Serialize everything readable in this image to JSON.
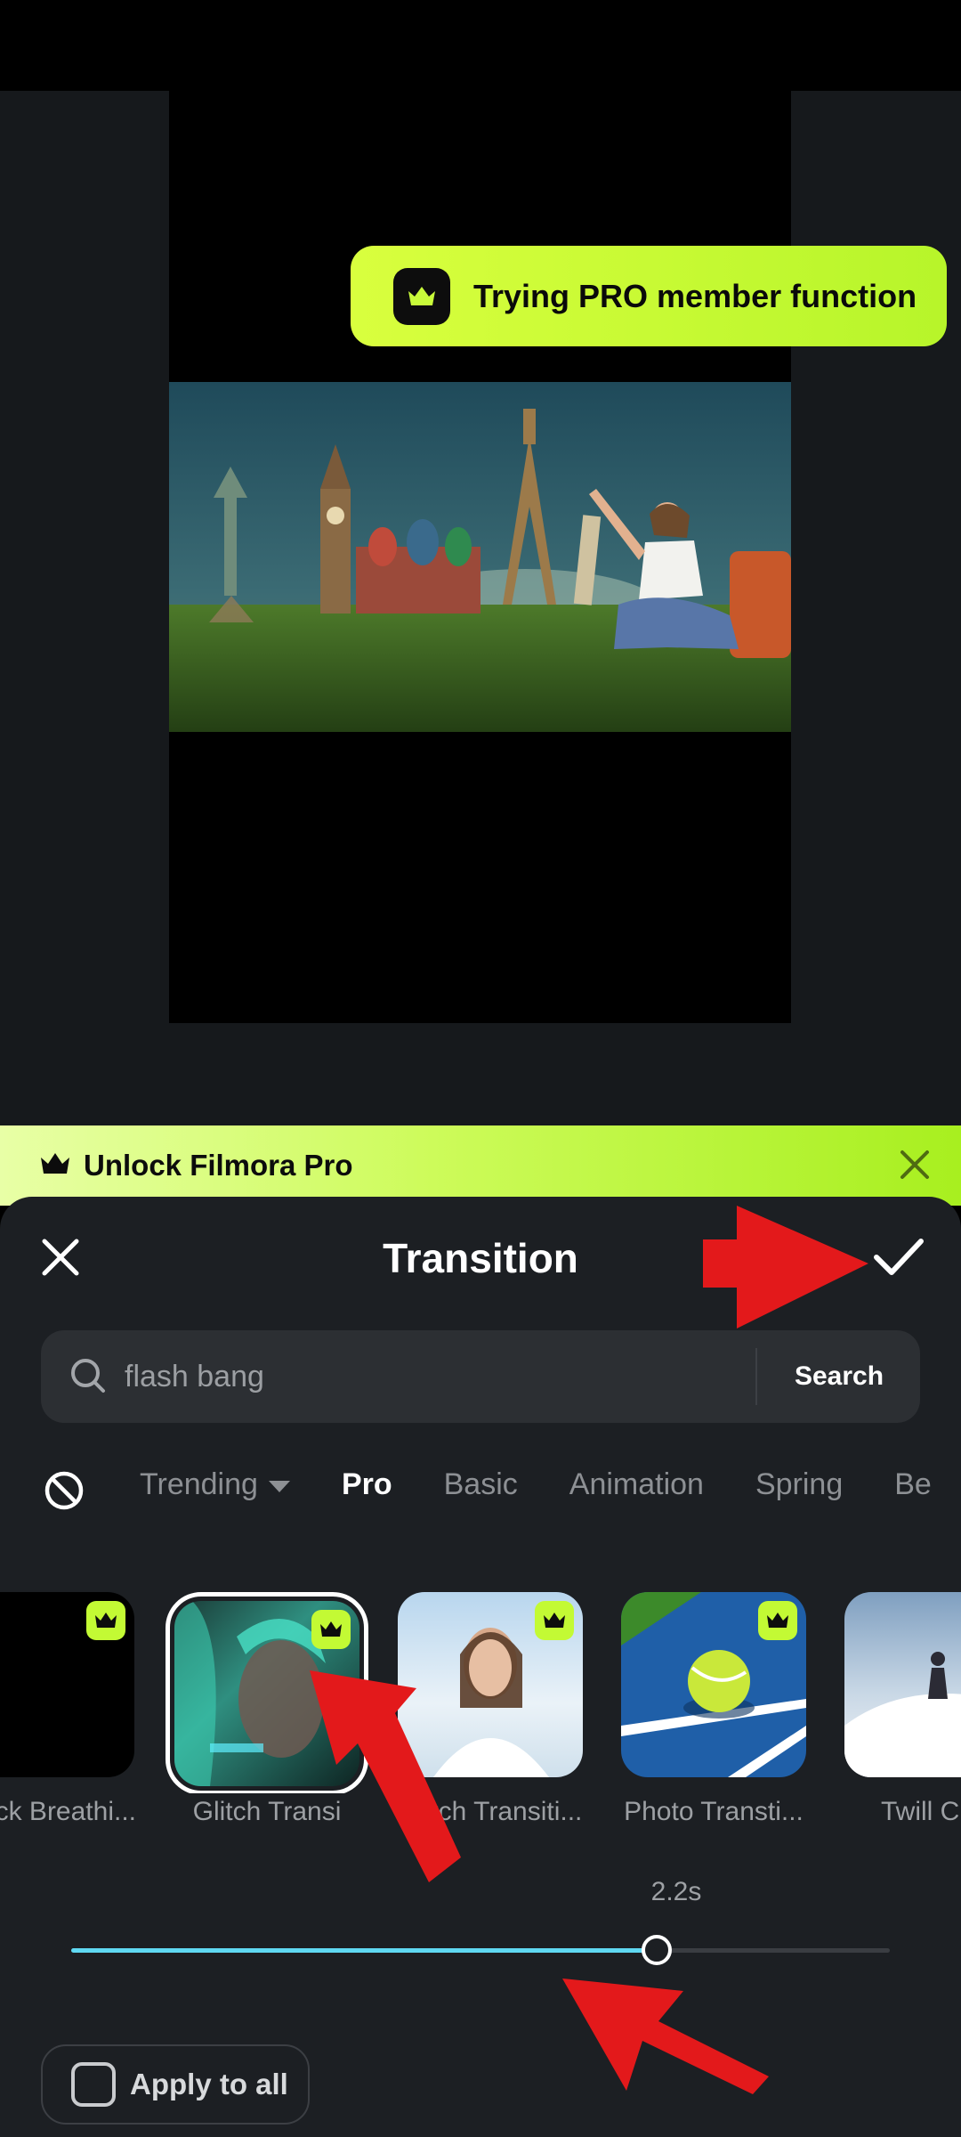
{
  "toast": {
    "text": "Trying PRO member function",
    "icon": "crown-icon"
  },
  "playback": {
    "control_icon": "pause-icon"
  },
  "unlock_banner": {
    "text": "Unlock Filmora Pro",
    "icon": "crown-icon",
    "close_icon": "close-icon"
  },
  "panel": {
    "title": "Transition",
    "close_icon": "close-icon",
    "confirm_icon": "checkmark-icon"
  },
  "search": {
    "value": "flash bang",
    "button_label": "Search",
    "icon": "search-icon"
  },
  "categories": {
    "none_icon": "no-transition-icon",
    "tabs": [
      "Trending",
      "Pro",
      "Basic",
      "Animation",
      "Spring",
      "Be"
    ],
    "active": "Pro"
  },
  "transitions": [
    {
      "label": "ck Breathi...",
      "pro": true,
      "selected": false
    },
    {
      "label": "Glitch Transi",
      "pro": true,
      "selected": true
    },
    {
      "label": "Glitch Transiti...",
      "pro": true,
      "selected": false
    },
    {
      "label": "Photo Transti...",
      "pro": true,
      "selected": false
    },
    {
      "label": "Twill C",
      "pro": false,
      "selected": false
    }
  ],
  "duration": {
    "label": "2.2s",
    "fraction": 0.715
  },
  "apply_all": {
    "label": "Apply to all",
    "checked": false
  },
  "colors": {
    "accent": "#c3fa34",
    "slider": "#5fd8f2",
    "panel": "#1c1f23",
    "annotation_arrow": "#e3191b"
  }
}
